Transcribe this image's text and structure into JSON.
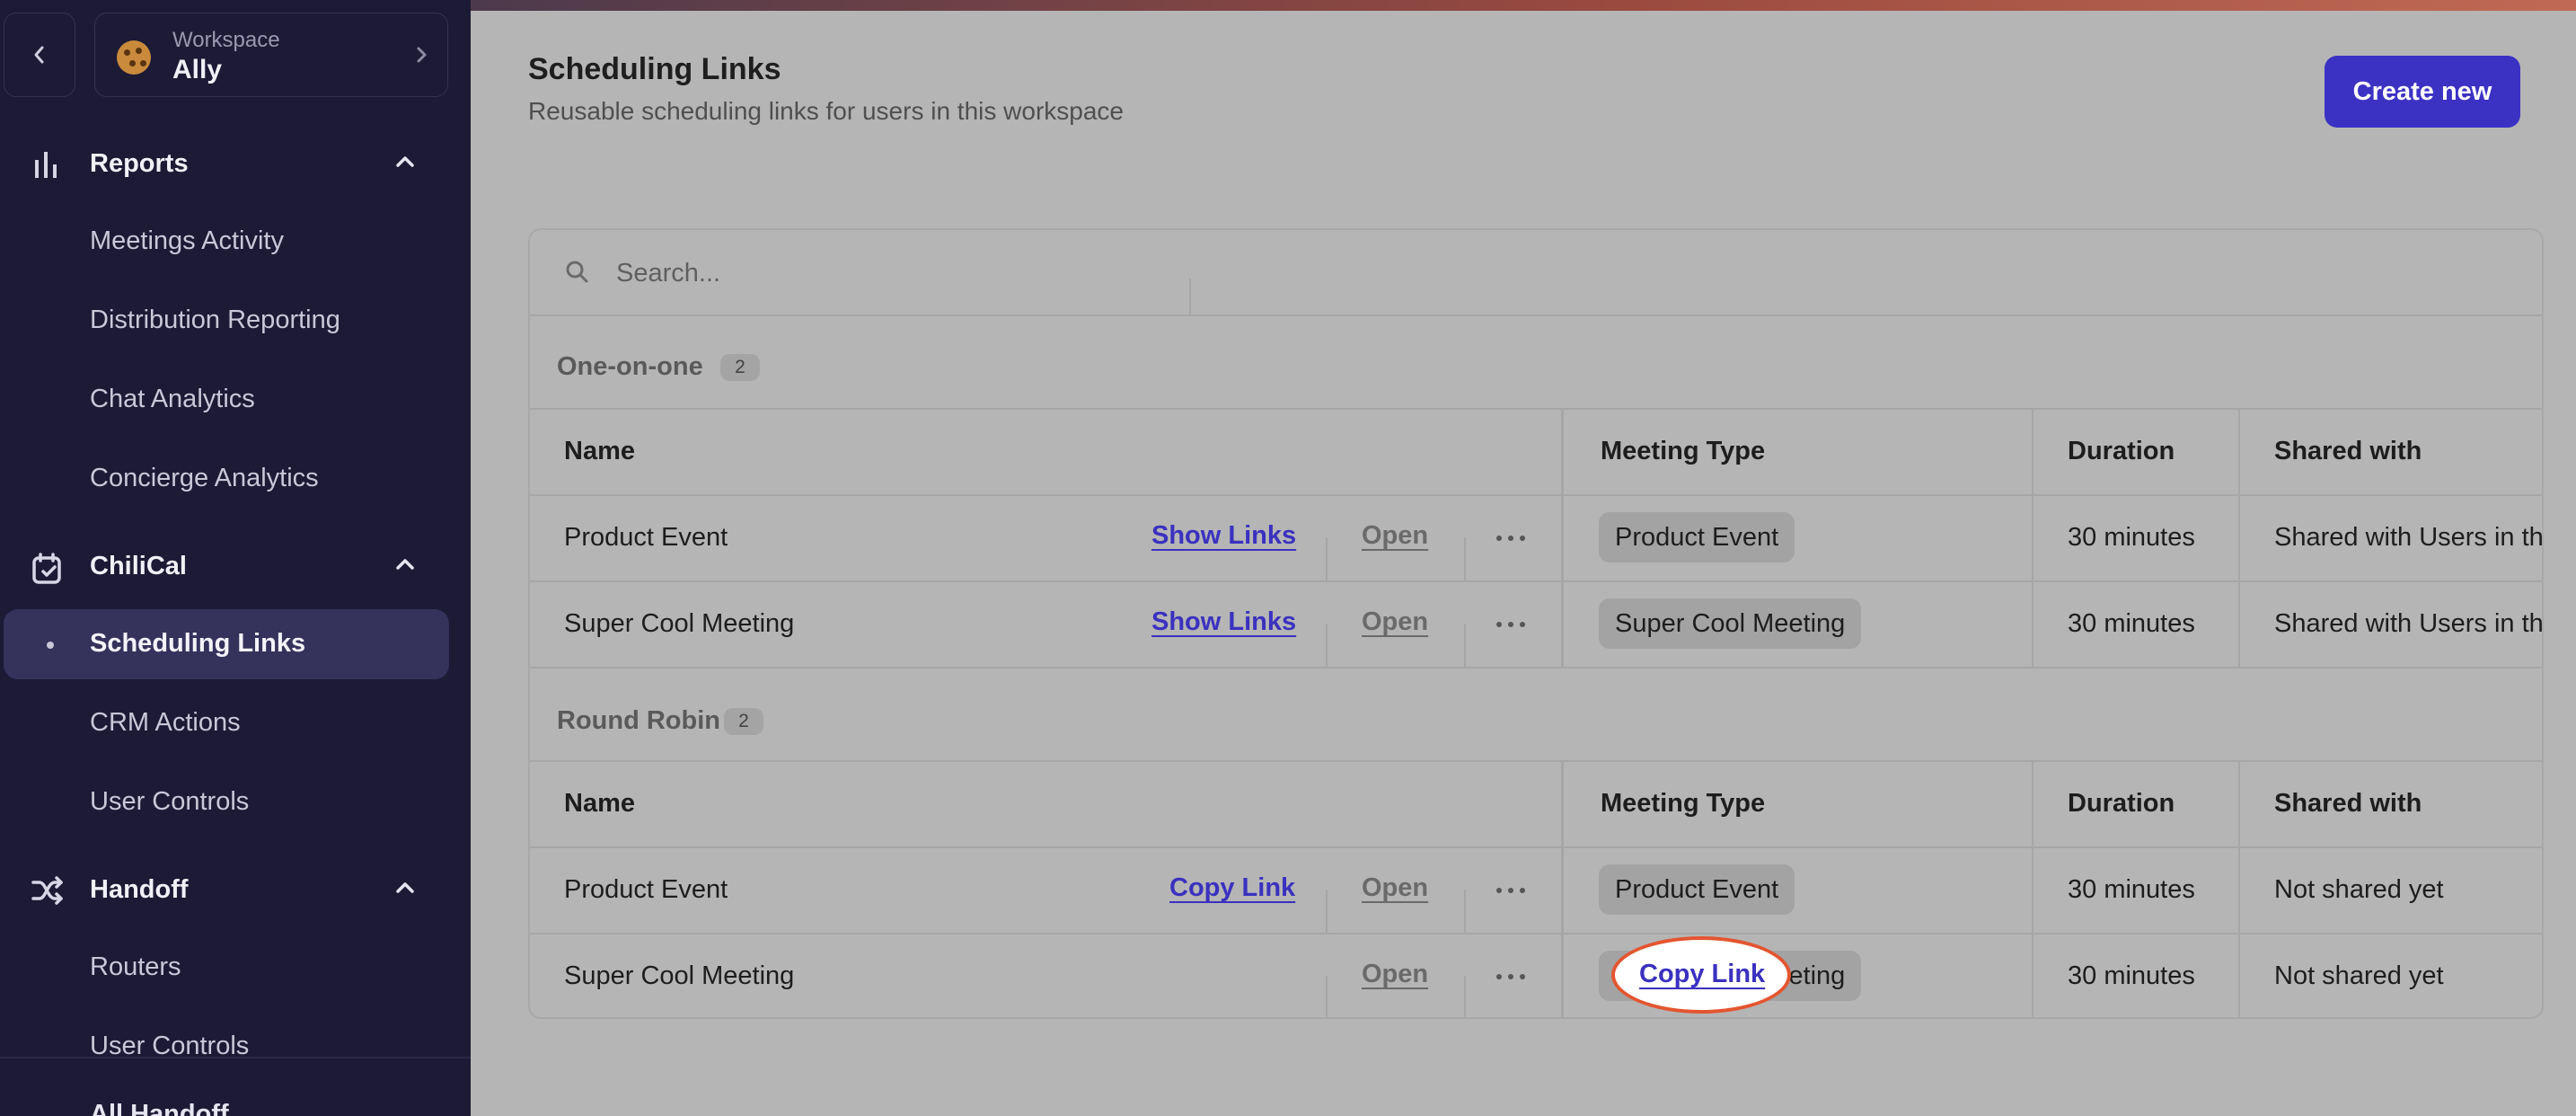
{
  "sidebar": {
    "workspace_kicker": "Workspace",
    "workspace_name": "Ally",
    "sections": [
      {
        "label": "Reports",
        "icon": "bar-chart-icon",
        "items": [
          "Meetings Activity",
          "Distribution Reporting",
          "Chat Analytics",
          "Concierge Analytics"
        ]
      },
      {
        "label": "ChiliCal",
        "icon": "calendar-icon",
        "items": [
          "Scheduling Links",
          "CRM Actions",
          "User Controls"
        ]
      },
      {
        "label": "Handoff",
        "icon": "shuffle-icon",
        "items": [
          "Routers",
          "User Controls",
          "All Handoff"
        ]
      }
    ],
    "active_item": "Scheduling Links"
  },
  "header": {
    "title": "Scheduling Links",
    "subtitle": "Reusable scheduling links for users in this workspace",
    "create_label": "Create new"
  },
  "search": {
    "placeholder": "Search..."
  },
  "columns": {
    "name": "Name",
    "meeting_type": "Meeting Type",
    "duration": "Duration",
    "shared_with": "Shared with"
  },
  "groups": [
    {
      "label": "One-on-one",
      "count": "2",
      "rows": [
        {
          "name": "Product Event",
          "action": "Show Links",
          "open": "Open",
          "meeting_type": "Product Event",
          "duration": "30 minutes",
          "shared_with": "Shared with Users in th"
        },
        {
          "name": "Super Cool Meeting",
          "action": "Show Links",
          "open": "Open",
          "meeting_type": "Super Cool Meeting",
          "duration": "30 minutes",
          "shared_with": "Shared with Users in th"
        }
      ]
    },
    {
      "label": "Round Robin",
      "count": "2",
      "rows": [
        {
          "name": "Product Event",
          "action": "Copy Link",
          "open": "Open",
          "meeting_type": "Product Event",
          "duration": "30 minutes",
          "shared_with": "Not shared yet"
        },
        {
          "name": "Super Cool Meeting",
          "action": "Copy Link",
          "open": "Open",
          "meeting_type": "Super Cool Meeting",
          "duration": "30 minutes",
          "shared_with": "Not shared yet"
        }
      ]
    }
  ],
  "colors": {
    "accent": "#3b32c4",
    "sidebar_bg": "#1c1a35",
    "highlight_ring": "#e4552f"
  }
}
